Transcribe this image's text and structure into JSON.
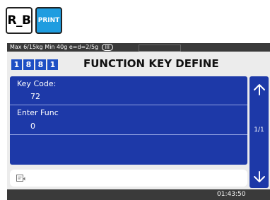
{
  "tiles": {
    "rb": "R_B",
    "print": "PRINT"
  },
  "status": {
    "text": "Max 6/15kg Min 40g e=d=2/5g",
    "badge": "III"
  },
  "header": {
    "digits": [
      "1",
      "8",
      "8",
      "1"
    ],
    "title": "FUNCTION KEY DEFINE"
  },
  "fields": {
    "key_code_label": "Key Code:",
    "key_code_value": "72",
    "enter_func_label": "Enter Func",
    "enter_func_value": "0"
  },
  "side": {
    "page": "1/1",
    "up_icon": "arrow-up-icon",
    "down_icon": "arrow-down-icon"
  },
  "input": {
    "icon": "edit-icon",
    "value": ""
  },
  "footer": {
    "time": "01:43:50"
  },
  "colors": {
    "panel": "#1d39a8",
    "digit_box": "#1d4fc4",
    "print_tile": "#1f9de0",
    "bars": "#3a3a3a"
  }
}
